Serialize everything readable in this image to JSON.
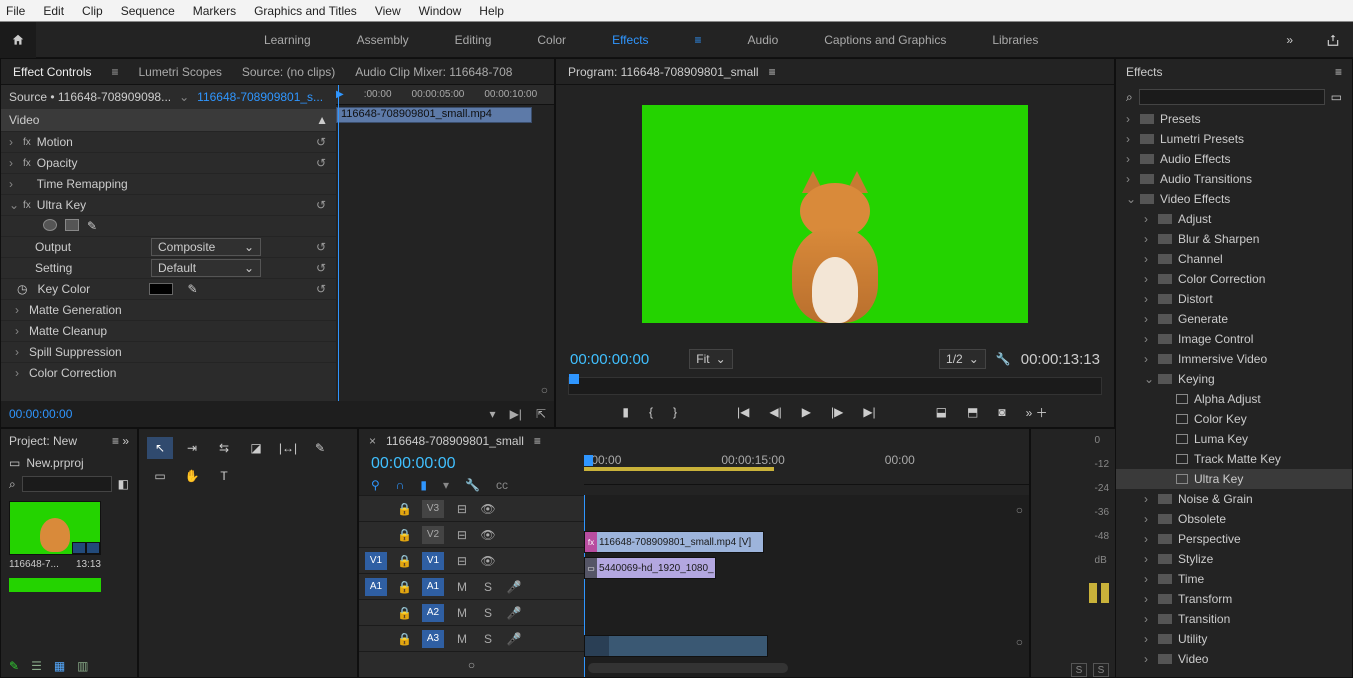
{
  "menu": [
    "File",
    "Edit",
    "Clip",
    "Sequence",
    "Markers",
    "Graphics and Titles",
    "View",
    "Window",
    "Help"
  ],
  "workspaces": {
    "items": [
      "Learning",
      "Assembly",
      "Editing",
      "Color",
      "Effects",
      "Audio",
      "Captions and Graphics",
      "Libraries"
    ],
    "active": "Effects"
  },
  "effect_controls": {
    "tabs": [
      "Effect Controls",
      "Lumetri Scopes",
      "Source: (no clips)",
      "Audio Clip Mixer: 116648-708"
    ],
    "source_label": "Source • 116648-708909098...",
    "seq_name": "116648-708909801_s...",
    "section": "Video",
    "rows": {
      "motion": "Motion",
      "opacity": "Opacity",
      "time_remap": "Time Remapping",
      "ultra_key": "Ultra Key",
      "output_label": "Output",
      "output_value": "Composite",
      "setting_label": "Setting",
      "setting_value": "Default",
      "key_color_label": "Key Color",
      "matte_gen": "Matte Generation",
      "matte_clean": "Matte Cleanup",
      "spill": "Spill Suppression",
      "color_corr": "Color Correction"
    },
    "ruler": [
      ":00:00",
      "00:00:05:00",
      "00:00:10:00"
    ],
    "clip_name": "116648-708909801_small.mp4",
    "timecode": "00:00:00:00"
  },
  "program": {
    "title": "Program: 116648-708909801_small",
    "tc_left": "00:00:00:00",
    "fit": "Fit",
    "zoom": "1/2",
    "tc_right": "00:00:13:13"
  },
  "project": {
    "title": "Project: New",
    "file": "New.prproj",
    "thumb_name": "116648-7...",
    "thumb_dur": "13:13"
  },
  "timeline": {
    "seq": "116648-708909801_small",
    "tc": "00:00:00:00",
    "ruler": [
      ":00:00",
      "00:00:15:00",
      "00:00"
    ],
    "tracks": {
      "v3": "V3",
      "v2": "V2",
      "v1": "V1",
      "a1": "A1",
      "a2": "A2",
      "a3": "A3"
    },
    "targets": {
      "v1": "V1",
      "a1": "A1"
    },
    "toggles": {
      "m": "M",
      "s": "S"
    },
    "clip_v3": "116648-708909801_small.mp4 [V]",
    "clip_v2": "5440069-hd_1920_1080_"
  },
  "meters": {
    "scale": [
      "0",
      "-12",
      "-24",
      "-36",
      "-48",
      "dB"
    ],
    "solo": "S"
  },
  "effects_panel": {
    "title": "Effects",
    "tree": [
      {
        "l": 1,
        "exp": false,
        "t": "folder",
        "label": "Presets"
      },
      {
        "l": 1,
        "exp": false,
        "t": "folder",
        "label": "Lumetri Presets"
      },
      {
        "l": 1,
        "exp": false,
        "t": "folder",
        "label": "Audio Effects"
      },
      {
        "l": 1,
        "exp": false,
        "t": "folder",
        "label": "Audio Transitions"
      },
      {
        "l": 1,
        "exp": true,
        "t": "folder",
        "label": "Video Effects"
      },
      {
        "l": 2,
        "exp": false,
        "t": "folder",
        "label": "Adjust"
      },
      {
        "l": 2,
        "exp": false,
        "t": "folder",
        "label": "Blur & Sharpen"
      },
      {
        "l": 2,
        "exp": false,
        "t": "folder",
        "label": "Channel"
      },
      {
        "l": 2,
        "exp": false,
        "t": "folder",
        "label": "Color Correction"
      },
      {
        "l": 2,
        "exp": false,
        "t": "folder",
        "label": "Distort"
      },
      {
        "l": 2,
        "exp": false,
        "t": "folder",
        "label": "Generate"
      },
      {
        "l": 2,
        "exp": false,
        "t": "folder",
        "label": "Image Control"
      },
      {
        "l": 2,
        "exp": false,
        "t": "folder",
        "label": "Immersive Video"
      },
      {
        "l": 2,
        "exp": true,
        "t": "folder",
        "label": "Keying"
      },
      {
        "l": 3,
        "exp": null,
        "t": "fx",
        "label": "Alpha Adjust"
      },
      {
        "l": 3,
        "exp": null,
        "t": "fx",
        "label": "Color Key"
      },
      {
        "l": 3,
        "exp": null,
        "t": "fx",
        "label": "Luma Key"
      },
      {
        "l": 3,
        "exp": null,
        "t": "fx",
        "label": "Track Matte Key"
      },
      {
        "l": 3,
        "exp": null,
        "t": "fx",
        "label": "Ultra Key",
        "sel": true
      },
      {
        "l": 2,
        "exp": false,
        "t": "folder",
        "label": "Noise & Grain"
      },
      {
        "l": 2,
        "exp": false,
        "t": "folder",
        "label": "Obsolete"
      },
      {
        "l": 2,
        "exp": false,
        "t": "folder",
        "label": "Perspective"
      },
      {
        "l": 2,
        "exp": false,
        "t": "folder",
        "label": "Stylize"
      },
      {
        "l": 2,
        "exp": false,
        "t": "folder",
        "label": "Time"
      },
      {
        "l": 2,
        "exp": false,
        "t": "folder",
        "label": "Transform"
      },
      {
        "l": 2,
        "exp": false,
        "t": "folder",
        "label": "Transition"
      },
      {
        "l": 2,
        "exp": false,
        "t": "folder",
        "label": "Utility"
      },
      {
        "l": 2,
        "exp": false,
        "t": "folder",
        "label": "Video"
      }
    ]
  }
}
